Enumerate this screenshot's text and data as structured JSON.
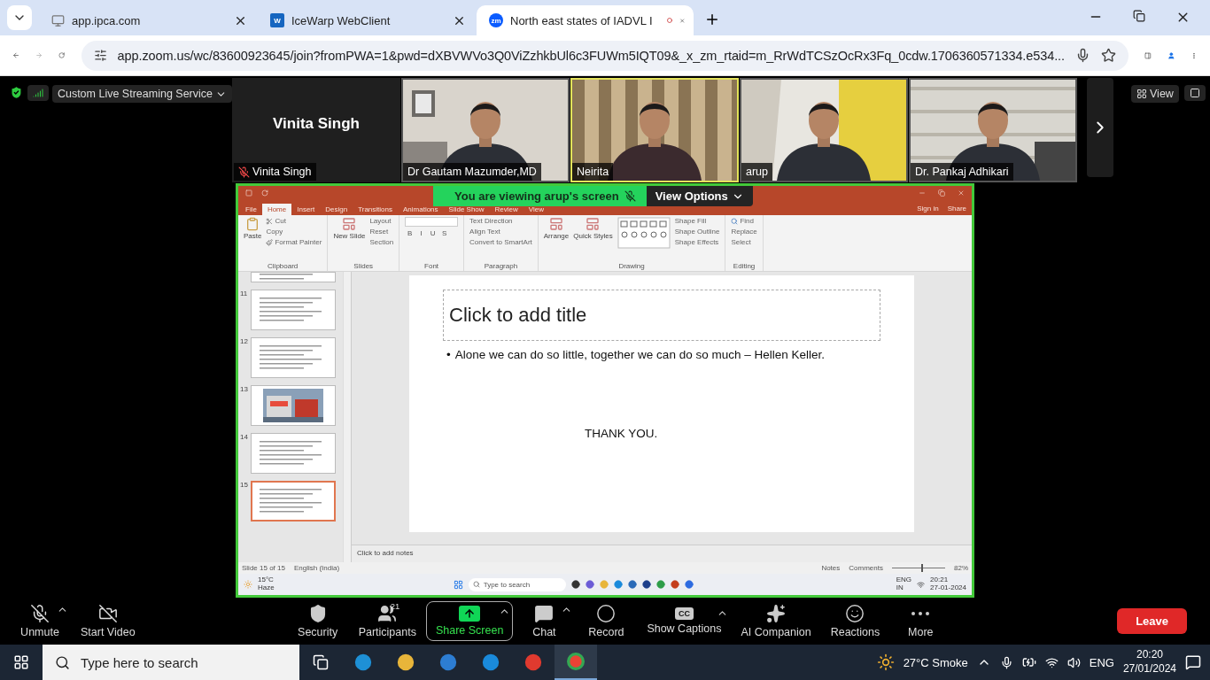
{
  "browser": {
    "tabs": [
      {
        "title": "app.ipca.com",
        "selected": false,
        "kind": "site",
        "recording": false
      },
      {
        "title": "IceWarp WebClient",
        "selected": false,
        "kind": "letter",
        "favicon_text": "W",
        "recording": false
      },
      {
        "title": "North east states of IADVL I",
        "selected": true,
        "kind": "letter",
        "favicon_text": "zm",
        "recording": true
      }
    ],
    "url": "app.zoom.us/wc/83600923645/join?fromPWA=1&pwd=dXBVWVo3Q0ViZzhkbUl6c3FUWm5IQT09&_x_zm_rtaid=m_RrWdTCSzOcRx3Fq_0cdw.1706360571334.e534..."
  },
  "zoom": {
    "service": "Custom Live Streaming Service",
    "view": "View",
    "participants": [
      {
        "name": "Vinita Singh",
        "display_name": "Vinita Singh",
        "kind": "avatar",
        "muted": true,
        "speaking": false
      },
      {
        "name": "Dr Gautam Mazumder,MD",
        "kind": "video",
        "muted": false,
        "speaking": false
      },
      {
        "name": "Neirita",
        "kind": "video",
        "muted": false,
        "speaking": true
      },
      {
        "name": "arup",
        "kind": "video",
        "muted": false,
        "speaking": false
      },
      {
        "name": "Dr. Pankaj Adhikari",
        "kind": "video",
        "muted": false,
        "speaking": false
      }
    ],
    "share": {
      "banner": "You are viewing arup's screen",
      "options": "View Options"
    },
    "toolbar": [
      {
        "label": "Unmute",
        "kind": "mic-off",
        "caret": true
      },
      {
        "label": "Start Video",
        "kind": "video-off",
        "caret": false
      },
      {
        "label": "Security",
        "kind": "shield",
        "caret": false
      },
      {
        "label": "Participants",
        "kind": "people",
        "caret": false,
        "count": "21"
      },
      {
        "label": "Share Screen",
        "kind": "share",
        "caret": true
      },
      {
        "label": "Chat",
        "kind": "chat",
        "caret": true
      },
      {
        "label": "Record",
        "kind": "record",
        "caret": false
      },
      {
        "label": "Show Captions",
        "kind": "captions",
        "caret": true,
        "icon_text": "CC"
      },
      {
        "label": "AI Companion",
        "kind": "sparkle",
        "caret": false
      },
      {
        "label": "Reactions",
        "kind": "reaction",
        "caret": false
      },
      {
        "label": "More",
        "kind": "more",
        "caret": false
      }
    ],
    "leave": "Leave"
  },
  "ppt": {
    "tabs": [
      {
        "label": "File",
        "selected": false
      },
      {
        "label": "Home",
        "selected": true
      },
      {
        "label": "Insert",
        "selected": false
      },
      {
        "label": "Design",
        "selected": false
      },
      {
        "label": "Transitions",
        "selected": false
      },
      {
        "label": "Animations",
        "selected": false
      },
      {
        "label": "Slide Show",
        "selected": false
      },
      {
        "label": "Review",
        "selected": false
      },
      {
        "label": "View",
        "selected": false
      }
    ],
    "sign_in": "Sign in",
    "share": "Share",
    "groups": [
      {
        "label": "Clipboard",
        "large": [
          "Paste"
        ],
        "small": [
          "Cut",
          "Copy",
          "Format Painter"
        ]
      },
      {
        "label": "Slides",
        "large": [
          "New Slide"
        ],
        "small": [
          "Layout",
          "Reset",
          "Section"
        ]
      },
      {
        "label": "Font",
        "row": [
          "B",
          "I",
          "U",
          "S"
        ]
      },
      {
        "label": "Paragraph",
        "small": [
          "Text Direction",
          "Align Text",
          "Convert to SmartArt"
        ]
      },
      {
        "label": "Drawing",
        "large": [
          "Arrange",
          "Quick Styles"
        ],
        "small": [
          "Shape Fill",
          "Shape Outline",
          "Shape Effects"
        ]
      },
      {
        "label": "Editing",
        "small": [
          "Find",
          "Replace",
          "Select"
        ]
      }
    ],
    "thumbnails": [
      {
        "kind": "text",
        "selected": false
      },
      {
        "number": "11",
        "kind": "text",
        "selected": false
      },
      {
        "number": "12",
        "kind": "text",
        "selected": false
      },
      {
        "number": "13",
        "selected": false
      },
      {
        "number": "14",
        "kind": "text",
        "selected": false
      },
      {
        "number": "15",
        "kind": "text",
        "selected": true
      }
    ],
    "slide": {
      "title_placeholder": "Click to add title",
      "bullet_mark": "•",
      "bullet": "Alone we can do so little, together we can do so much – Hellen Keller.",
      "closing": "THANK YOU."
    },
    "notes_placeholder": "Click to add notes",
    "status": {
      "slide": "Slide 15 of 15",
      "language": "English (India)",
      "notes": "Notes",
      "comments": "Comments",
      "zoom_slider": {
        "level": 0.55
      },
      "zoom": "82%"
    },
    "taskbar": {
      "temp": "15°C",
      "condition": "Haze",
      "search": "Type to search",
      "lang": "ENG",
      "region": "IN",
      "time": "20:21",
      "date": "27-01-2024"
    }
  },
  "taskbar": {
    "search": "Type here to search",
    "temp": "27°C",
    "condition": "Smoke",
    "lang": "ENG",
    "time": "20:20",
    "date": "27/01/2024"
  }
}
